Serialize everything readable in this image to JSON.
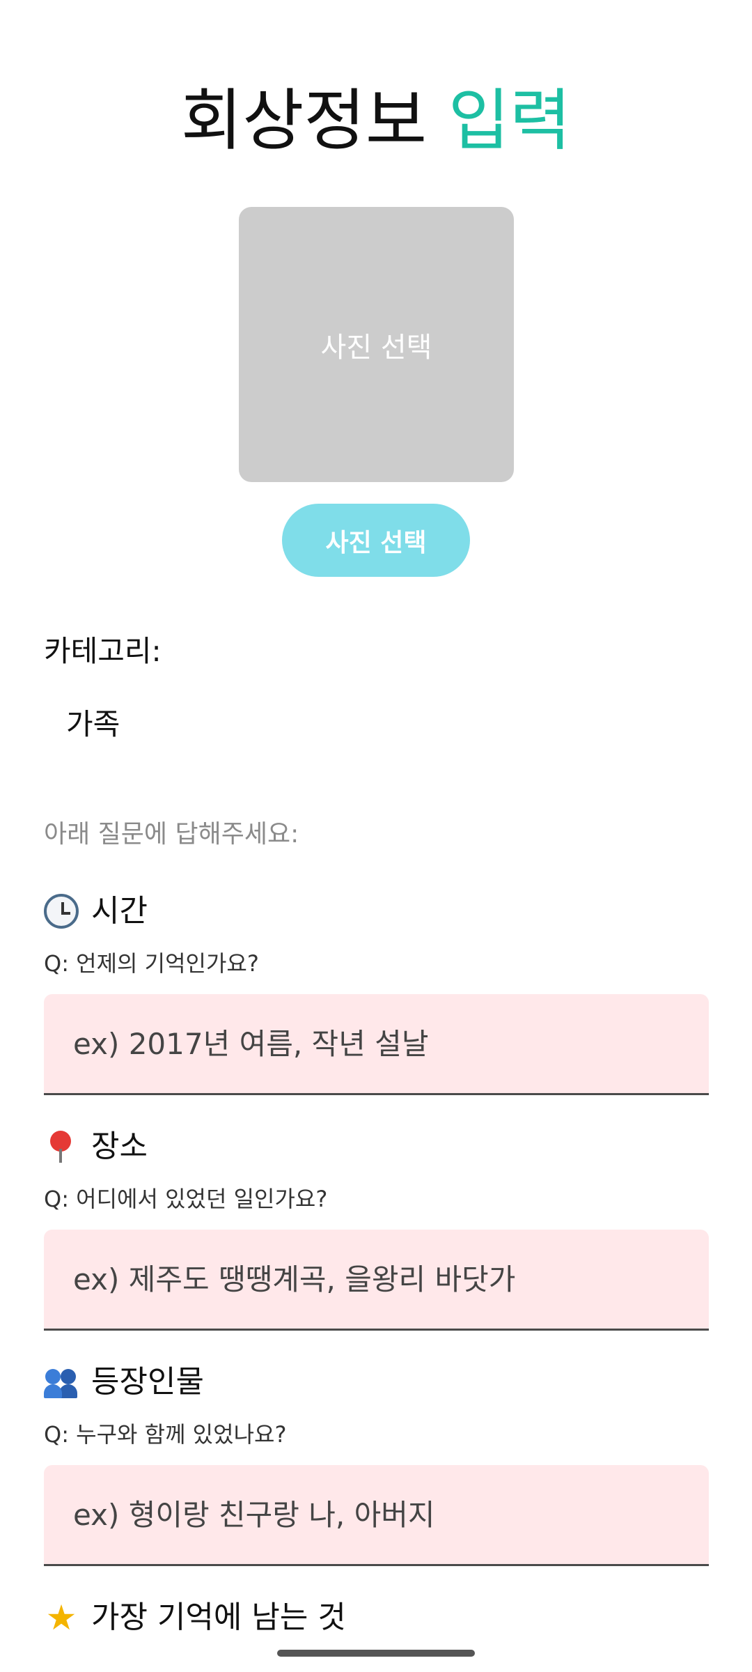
{
  "header": {
    "title_main": "회상정보",
    "title_accent": "입력"
  },
  "photo": {
    "box_label": "사진 선택",
    "button_label": "사진 선택"
  },
  "category": {
    "label": "카테고리:",
    "value": "가족"
  },
  "instruction": "아래 질문에 답해주세요:",
  "questions": [
    {
      "icon": "clock-icon",
      "heading": "시간",
      "question": "Q: 언제의 기억인가요?",
      "placeholder": "ex) 2017년 여름, 작년 설날"
    },
    {
      "icon": "pin-icon",
      "heading": "장소",
      "question": "Q: 어디에서 있었던 일인가요?",
      "placeholder": "ex) 제주도 땡땡계곡, 을왕리 바닷가"
    },
    {
      "icon": "people-icon",
      "heading": "등장인물",
      "question": "Q: 누구와 함께 있었나요?",
      "placeholder": "ex) 형이랑 친구랑 나, 아버지"
    },
    {
      "icon": "star-icon",
      "heading": "가장 기억에 남는 것"
    }
  ],
  "colors": {
    "accent": "#1dbfa3",
    "button": "#7fdde9",
    "field_bg": "#ffe8ea",
    "photo_box": "#cccccc"
  }
}
